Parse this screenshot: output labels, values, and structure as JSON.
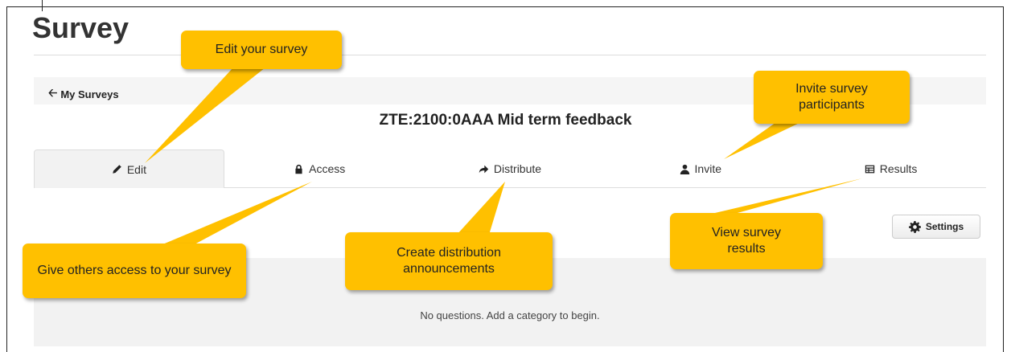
{
  "page": {
    "title": "Survey"
  },
  "nav": {
    "back_label": "My Surveys"
  },
  "survey": {
    "name": "ZTE:2100:0AAA Mid term feedback"
  },
  "tabs": [
    {
      "label": "Edit",
      "icon": "pencil-icon",
      "active": true
    },
    {
      "label": "Access",
      "icon": "lock-icon",
      "active": false
    },
    {
      "label": "Distribute",
      "icon": "share-arrow-icon",
      "active": false
    },
    {
      "label": "Invite",
      "icon": "user-icon",
      "active": false
    },
    {
      "label": "Results",
      "icon": "table-icon",
      "active": false
    }
  ],
  "toolbar": {
    "settings_label": "Settings"
  },
  "content": {
    "empty_message": "No questions. Add a category to begin."
  },
  "callouts": {
    "edit": "Edit your survey",
    "invite": "Invite survey participants",
    "access": "Give others access to your survey",
    "distribute": "Create distribution announcements",
    "results": "View survey results"
  },
  "colors": {
    "callout": "#ffc000",
    "tab_active_bg": "#f2f2f2",
    "panel_bg": "#f2f2f2"
  }
}
